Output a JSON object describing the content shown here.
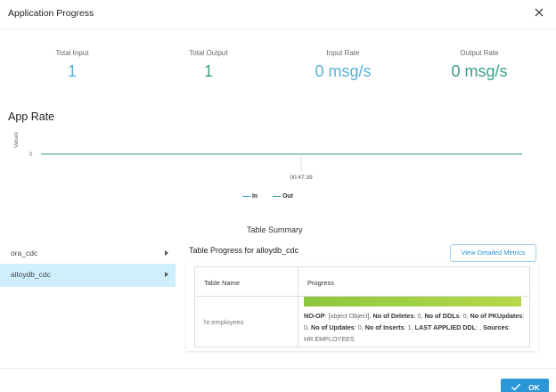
{
  "dialog": {
    "title": "Application Progress"
  },
  "stats": [
    {
      "label": "Total Input",
      "value": "1"
    },
    {
      "label": "Total Output",
      "value": "1"
    },
    {
      "label": "Input Rate",
      "value": "0 msg/s"
    },
    {
      "label": "Output Rate",
      "value": "0 msg/s"
    }
  ],
  "app_rate": {
    "heading": "App Rate",
    "y_axis_title": "Values",
    "y_tick": "0",
    "x_tick": "00:47:39",
    "legend": [
      {
        "name": "In",
        "color": "#3aa6d8"
      },
      {
        "name": "Out",
        "color": "#3d9e8c"
      }
    ]
  },
  "chart_data": {
    "type": "line",
    "title": "App Rate",
    "ylabel": "Values",
    "xlabel": "",
    "x": [
      "00:47:39"
    ],
    "series": [
      {
        "name": "In",
        "values": [
          0
        ]
      },
      {
        "name": "Out",
        "values": [
          0
        ]
      }
    ],
    "grid": false,
    "legend_position": "bottom-center"
  },
  "summary": {
    "title": "Table Summary",
    "apps": [
      {
        "label": "ora_cdc",
        "active": false
      },
      {
        "label": "alloydb_cdc",
        "active": true
      }
    ],
    "progress_title": "Table Progress for alloydb_cdc",
    "view_button": "View Detailed Metrics",
    "table": {
      "headers": [
        "Table Name",
        "Progress"
      ],
      "rows": [
        {
          "name": "hr.employees",
          "progress_fraction": 1.0,
          "details": [
            {
              "key": "NO-OP",
              "value": "[object Object]"
            },
            {
              "key": "No of Deletes",
              "value": "0"
            },
            {
              "key": "No of DDLs",
              "value": "0"
            },
            {
              "key": "No of PKUpdates",
              "value": "0"
            },
            {
              "key": "No of Updates",
              "value": "0"
            },
            {
              "key": "No of Inserts",
              "value": "1"
            },
            {
              "key": "LAST APPLIED DDL",
              "value": ""
            },
            {
              "key": "Sources",
              "value": "HR.EMPLOYEES"
            }
          ]
        }
      ]
    }
  },
  "footer": {
    "ok_label": "OK"
  },
  "colors": {
    "accent": "#2b97d6",
    "input_value": "#5ab0d6",
    "output_value": "#3d9e8c",
    "progress_fill": "#9ccc3c"
  }
}
